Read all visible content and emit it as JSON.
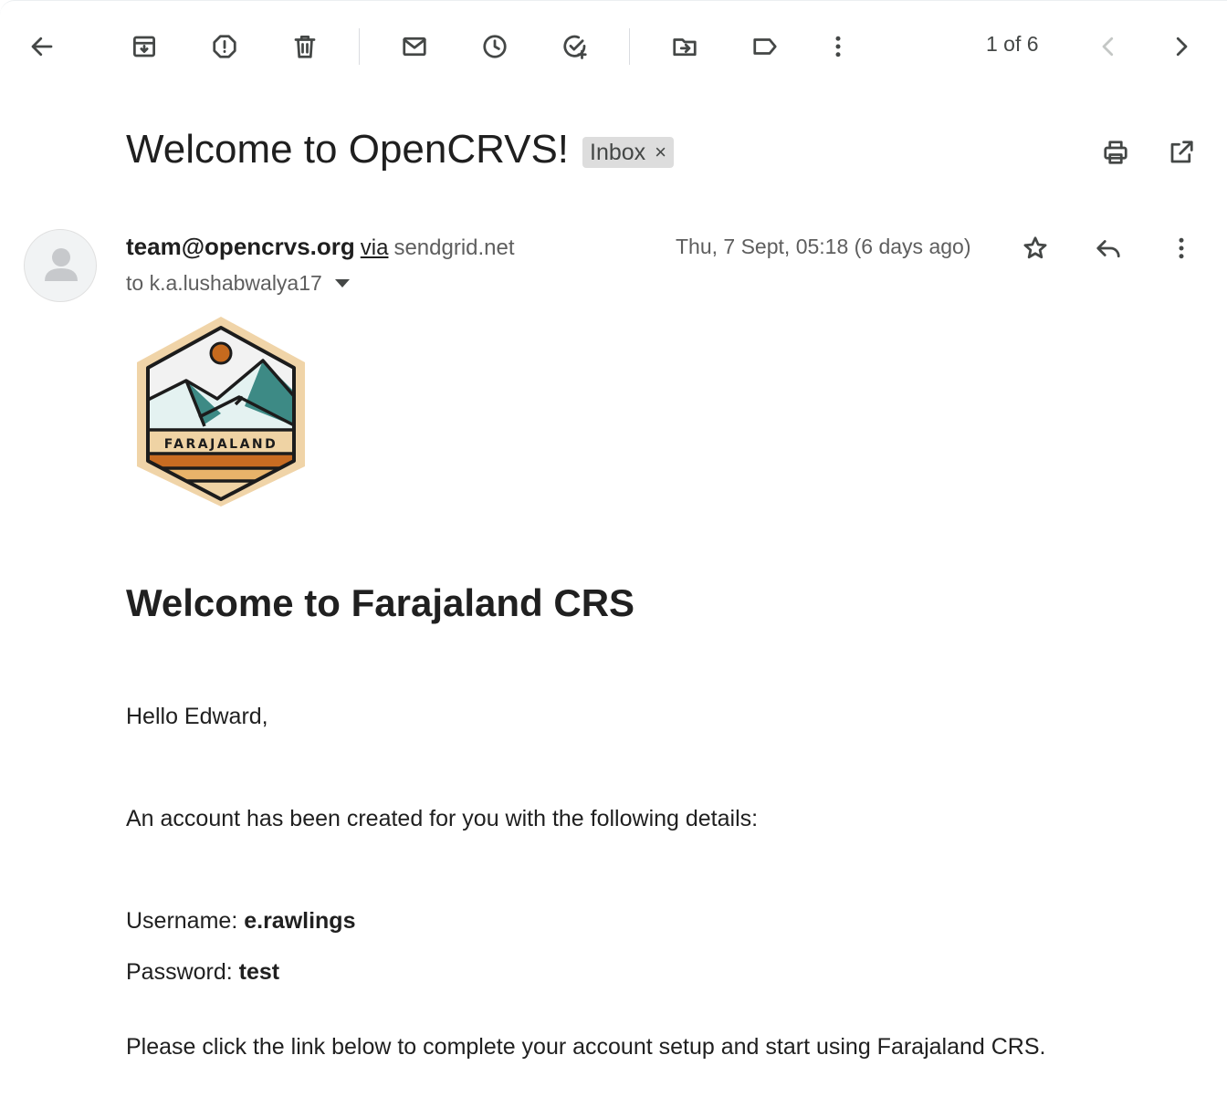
{
  "toolbar": {
    "pager_text": "1 of 6"
  },
  "email": {
    "subject": "Welcome to OpenCRVS!",
    "label": "Inbox",
    "label_remove": "×",
    "sender_email": "team@opencrvs.org",
    "sender_via": "via",
    "sender_domain": "sendgrid.net",
    "recipient": "to k.a.lushabwalya17",
    "date": "Thu, 7 Sept, 05:18 (6 days ago)"
  },
  "logo": {
    "text": "FARAJALAND",
    "colors": {
      "outline": "#1c1c1c",
      "border": "#f0d4a8",
      "sky": "#f2f2f2",
      "sun": "#c66a1e",
      "mountain_dark": "#3d8a85",
      "mountain_light": "#e4f2f1",
      "band": "#efd3a4",
      "stripe_orange": "#c86c22",
      "stripe_light": "#e8b36a"
    }
  },
  "body": {
    "heading": "Welcome to Farajaland CRS",
    "greeting": "Hello Edward,",
    "intro": "An account has been created for you with the following details:",
    "username_label": "Username:",
    "username_value": "e.rawlings",
    "password_label": "Password:",
    "password_value": "test",
    "cta_text": "Please click the link below to complete your account setup and start using Farajaland CRS."
  }
}
